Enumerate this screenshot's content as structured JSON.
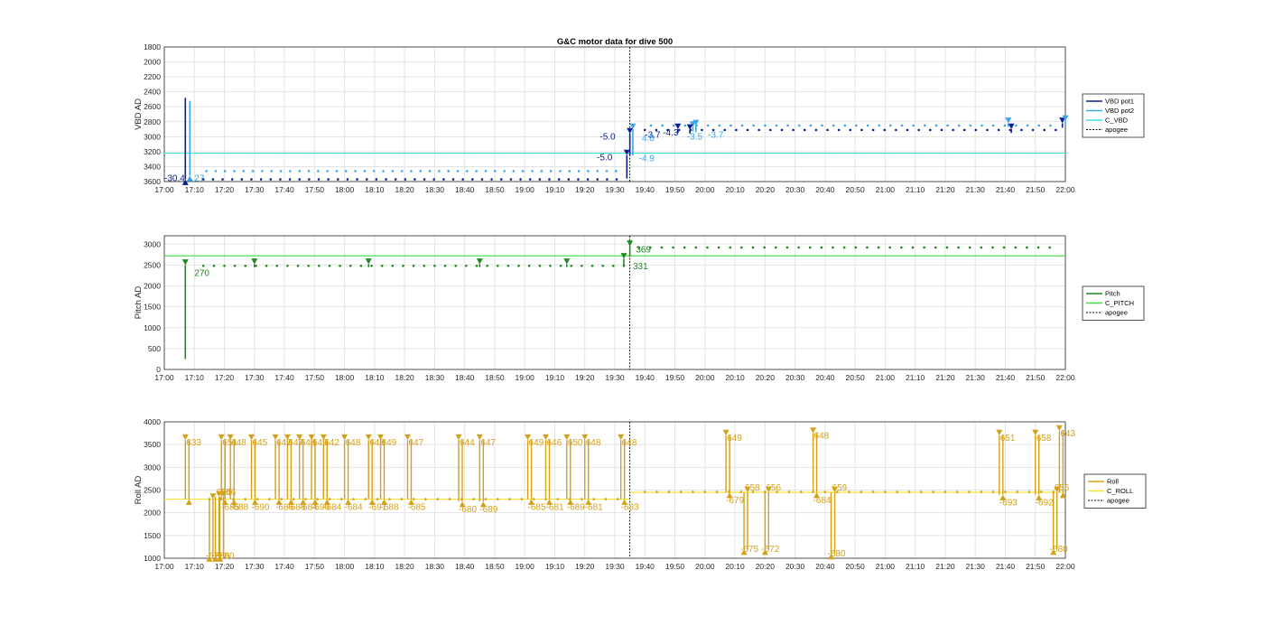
{
  "chart_data": [
    {
      "type": "line",
      "title": "G&C motor data for dive 500",
      "ylabel": "VBD AD",
      "y_reversed": true,
      "ylim": [
        1800,
        3600
      ],
      "yticks": [
        "1800",
        "2000",
        "2200",
        "2400",
        "2600",
        "2800",
        "3000",
        "3200",
        "3400",
        "3600"
      ],
      "xlim_min": [
        0,
        300
      ],
      "xticks": [
        "17:00",
        "17:10",
        "17:20",
        "17:30",
        "17:40",
        "17:50",
        "18:00",
        "18:10",
        "18:20",
        "18:30",
        "18:40",
        "18:50",
        "19:00",
        "19:10",
        "19:20",
        "19:30",
        "19:40",
        "19:50",
        "20:00",
        "20:10",
        "20:20",
        "20:30",
        "20:40",
        "20:50",
        "21:00",
        "21:10",
        "21:20",
        "21:30",
        "21:40",
        "21:50",
        "22:00"
      ],
      "grid": true,
      "legend_position": "outside-right",
      "legend": [
        "VBD pot1",
        "VBD pot2",
        "C_VBD",
        "apogee"
      ],
      "colors": {
        "pot1": "#0a1f8f",
        "pot2": "#3aa7e8",
        "c_line": "#3de0e0",
        "apogee": "#000000"
      },
      "apogee_min": 155,
      "c_value": 3220,
      "pot1_dots_a": {
        "start": 13,
        "end": 153,
        "step": 3.2,
        "value": 3570
      },
      "pot1_dots_b": {
        "start": 160,
        "end": 298,
        "step": 3.8,
        "value": 2910
      },
      "pot2_dots_a": {
        "start": 14,
        "end": 153,
        "step": 3.1,
        "value": 3460
      },
      "pot2_dots_b": {
        "start": 162,
        "end": 298,
        "step": 3.8,
        "value": 2850
      },
      "arrows": [
        {
          "x": 7,
          "from": 2480,
          "to": 3570,
          "series": "pot1"
        },
        {
          "x": 8.5,
          "from": 2520,
          "to": 3520,
          "series": "pot2"
        },
        {
          "x": 154,
          "from": 3560,
          "to": 3250,
          "series": "pot1"
        },
        {
          "x": 155,
          "from": 3250,
          "to": 2960,
          "series": "pot1"
        },
        {
          "x": 156,
          "from": 3250,
          "to": 2900,
          "series": "pot2"
        },
        {
          "x": 171,
          "from": 2950,
          "to": 2900,
          "series": "pot1"
        },
        {
          "x": 176,
          "from": 2930,
          "to": 2870,
          "series": "pot2"
        },
        {
          "x": 175,
          "from": 2960,
          "to": 2910,
          "series": "pot1"
        },
        {
          "x": 177,
          "from": 2940,
          "to": 2850,
          "series": "pot2"
        },
        {
          "x": 282,
          "from": 2950,
          "to": 2900,
          "series": "pot1"
        },
        {
          "x": 281,
          "from": 2870,
          "to": 2820,
          "series": "pot2"
        },
        {
          "x": 299,
          "from": 2880,
          "to": 2820,
          "series": "pot1"
        },
        {
          "x": 300,
          "from": 2840,
          "to": 2790,
          "series": "pot2"
        }
      ],
      "labels": [
        {
          "text": "-30.4",
          "x": 0,
          "y": 3560,
          "series": "pot1"
        },
        {
          "text": "27",
          "x": 10,
          "y": 3560,
          "series": "pot2"
        },
        {
          "text": "-5.0",
          "x": 145,
          "y": 3000,
          "series": "pot1"
        },
        {
          "text": "-5.0",
          "x": 144,
          "y": 3280,
          "series": "pot1"
        },
        {
          "text": "-4.9",
          "x": 158,
          "y": 3290,
          "series": "pot2"
        },
        {
          "text": "-3.7",
          "x": 160,
          "y": 2980,
          "series": "pot1"
        },
        {
          "text": "4.8",
          "x": 159,
          "y": 3020,
          "series": "pot2"
        },
        {
          "text": "-4.3",
          "x": 166,
          "y": 2950,
          "series": "pot1"
        },
        {
          "text": "-3.5",
          "x": 174,
          "y": 3000,
          "series": "pot2"
        },
        {
          "text": "-3.7",
          "x": 181,
          "y": 2980,
          "series": "pot2"
        }
      ]
    },
    {
      "type": "line",
      "ylabel": "Pitch AD",
      "ylim": [
        0,
        3200
      ],
      "yticks": [
        "0",
        "500",
        "1000",
        "1500",
        "2000",
        "2500",
        "3000"
      ],
      "xlim_min": [
        0,
        300
      ],
      "xticks": [
        "17:00",
        "17:10",
        "17:20",
        "17:30",
        "17:40",
        "17:50",
        "18:00",
        "18:10",
        "18:20",
        "18:30",
        "18:40",
        "18:50",
        "19:00",
        "19:10",
        "19:20",
        "19:30",
        "19:40",
        "19:50",
        "20:00",
        "20:10",
        "20:20",
        "20:30",
        "20:40",
        "20:50",
        "21:00",
        "21:10",
        "21:20",
        "21:30",
        "21:40",
        "21:50",
        "22:00"
      ],
      "grid": true,
      "legend_position": "outside-right",
      "legend": [
        "Pitch",
        "C_PITCH",
        "apogee"
      ],
      "colors": {
        "pitch": "#1f8a1f",
        "c_line": "#3ddc3d",
        "apogee": "#000000"
      },
      "apogee_min": 155,
      "c_value": 2720,
      "dots_a": {
        "start": 13,
        "end": 153,
        "step": 3.5,
        "value": 2480
      },
      "dots_b": {
        "start": 158,
        "end": 298,
        "step": 3.8,
        "value": 2920
      },
      "arrows": [
        {
          "x": 7,
          "from": 250,
          "to": 2500
        },
        {
          "x": 153,
          "from": 2500,
          "to": 2650
        },
        {
          "x": 155,
          "from": 2700,
          "to": 2950
        },
        {
          "x": 30,
          "from": 2450,
          "to": 2520
        },
        {
          "x": 68,
          "from": 2450,
          "to": 2520
        },
        {
          "x": 105,
          "from": 2450,
          "to": 2520
        },
        {
          "x": 134,
          "from": 2450,
          "to": 2520
        }
      ],
      "labels": [
        {
          "text": "270",
          "x": 10,
          "y": 2300
        },
        {
          "text": "369",
          "x": 157,
          "y": 2860
        },
        {
          "text": "331",
          "x": 156,
          "y": 2470
        }
      ]
    },
    {
      "type": "line",
      "ylabel": "Roll AD",
      "ylim": [
        1000,
        4000
      ],
      "yticks": [
        "1000",
        "1500",
        "2000",
        "2500",
        "3000",
        "3500",
        "4000"
      ],
      "xlim_min": [
        0,
        300
      ],
      "xticks": [
        "17:00",
        "17:10",
        "17:20",
        "17:30",
        "17:40",
        "17:50",
        "18:00",
        "18:10",
        "18:20",
        "18:30",
        "18:40",
        "18:50",
        "19:00",
        "19:10",
        "19:20",
        "19:30",
        "19:40",
        "19:50",
        "20:00",
        "20:10",
        "20:20",
        "20:30",
        "20:40",
        "20:50",
        "21:00",
        "21:10",
        "21:20",
        "21:30",
        "21:40",
        "21:50",
        "22:00"
      ],
      "grid": true,
      "legend_position": "outside-right",
      "legend": [
        "Roll",
        "C_ROLL",
        "apogee"
      ],
      "colors": {
        "roll": "#d4a017",
        "c_line": "#f2e33a",
        "apogee": "#000000"
      },
      "apogee_min": 155,
      "c_value_a": 2300,
      "c_value_b": 2450,
      "dots_a": {
        "start": 15,
        "end": 153,
        "step": 4,
        "value": 2300
      },
      "dots_b": {
        "start": 160,
        "end": 298,
        "step": 4,
        "value": 2460
      },
      "up_pairs": [
        {
          "x": 7,
          "top": 3600,
          "bottom": 2300,
          "up": "633",
          "down": ""
        },
        {
          "x": 19,
          "top": 3600,
          "bottom": 2300,
          "up": "651",
          "down": "-685"
        },
        {
          "x": 22,
          "top": 3600,
          "bottom": 2300,
          "up": "648",
          "down": "-688"
        },
        {
          "x": 29,
          "top": 3600,
          "bottom": 2300,
          "up": "645",
          "down": "-690"
        },
        {
          "x": 37,
          "top": 3600,
          "bottom": 2300,
          "up": "647",
          "down": "-686"
        },
        {
          "x": 41,
          "top": 3600,
          "bottom": 2300,
          "up": "647",
          "down": "-688"
        },
        {
          "x": 45,
          "top": 3600,
          "bottom": 2300,
          "up": "648",
          "down": "-684"
        },
        {
          "x": 49,
          "top": 3600,
          "bottom": 2300,
          "up": "649",
          "down": "-690"
        },
        {
          "x": 53,
          "top": 3600,
          "bottom": 2300,
          "up": "642",
          "down": "-684"
        },
        {
          "x": 60,
          "top": 3600,
          "bottom": 2300,
          "up": "648",
          "down": "-684"
        },
        {
          "x": 68,
          "top": 3600,
          "bottom": 2300,
          "up": "648",
          "down": "-691"
        },
        {
          "x": 72,
          "top": 3600,
          "bottom": 2300,
          "up": "649",
          "down": "-688"
        },
        {
          "x": 81,
          "top": 3600,
          "bottom": 2300,
          "up": "647",
          "down": "-685"
        },
        {
          "x": 98,
          "top": 3600,
          "bottom": 2250,
          "up": "644",
          "down": "-680"
        },
        {
          "x": 105,
          "top": 3600,
          "bottom": 2250,
          "up": "647",
          "down": "-689"
        },
        {
          "x": 121,
          "top": 3600,
          "bottom": 2300,
          "up": "649",
          "down": "-685"
        },
        {
          "x": 127,
          "top": 3600,
          "bottom": 2300,
          "up": "646",
          "down": "-681"
        },
        {
          "x": 134,
          "top": 3600,
          "bottom": 2300,
          "up": "650",
          "down": "-689"
        },
        {
          "x": 140,
          "top": 3600,
          "bottom": 2300,
          "up": "648",
          "down": "-681"
        },
        {
          "x": 152,
          "top": 3600,
          "bottom": 2300,
          "up": "648",
          "down": "-683"
        },
        {
          "x": 187,
          "top": 3700,
          "bottom": 2450,
          "up": "649",
          "down": "-679"
        },
        {
          "x": 216,
          "top": 3750,
          "bottom": 2450,
          "up": "648",
          "down": "-684"
        },
        {
          "x": 278,
          "top": 3700,
          "bottom": 2400,
          "up": "651",
          "down": "-693"
        },
        {
          "x": 290,
          "top": 3700,
          "bottom": 2400,
          "up": "658",
          "down": "-692"
        },
        {
          "x": 298,
          "top": 3800,
          "bottom": 2450,
          "up": "643",
          "down": ""
        }
      ],
      "down_pairs": [
        {
          "x": 15,
          "top": 2300,
          "bottom": 1050,
          "up": "",
          "down": "-67"
        },
        {
          "x": 17,
          "top": 2350,
          "bottom": 1050,
          "up": "654",
          "down": "-686"
        },
        {
          "x": 18.5,
          "top": 2350,
          "bottom": 1050,
          "up": "656",
          "down": "-680"
        },
        {
          "x": 193,
          "top": 2450,
          "bottom": 1200,
          "up": "658",
          "down": "-675"
        },
        {
          "x": 200,
          "top": 2450,
          "bottom": 1200,
          "up": "656",
          "down": "-672"
        },
        {
          "x": 222,
          "top": 2450,
          "bottom": 1100,
          "up": "659",
          "down": "-680"
        },
        {
          "x": 296,
          "top": 2450,
          "bottom": 1200,
          "up": "656",
          "down": "-680"
        }
      ]
    }
  ]
}
